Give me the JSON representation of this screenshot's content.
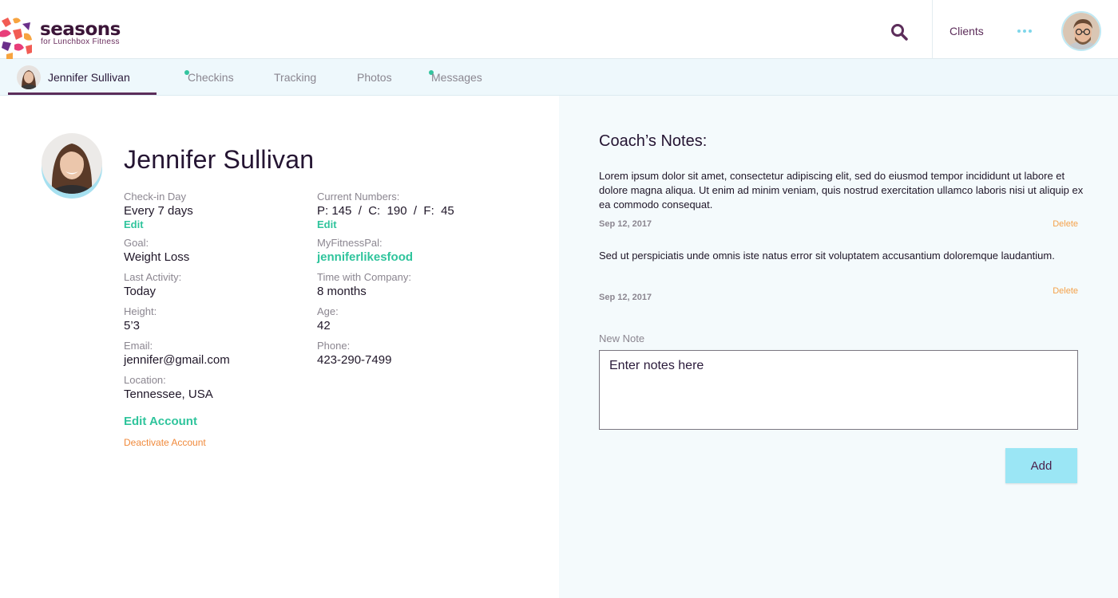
{
  "header": {
    "brand": "seasons",
    "brand_sub": "for Lunchbox Fitness",
    "clients_label": "Clients",
    "icons": {
      "search": "search-icon",
      "more": "more-dots-icon"
    },
    "colors": {
      "primary": "#5c2d5a",
      "accent": "#2fc49c",
      "light_accent": "#9be6f5",
      "warning": "#f08a3c"
    }
  },
  "tabs": [
    {
      "label": "Jennifer Sullivan",
      "active": true,
      "dot": false
    },
    {
      "label": "Checkins",
      "active": false,
      "dot": true
    },
    {
      "label": "Tracking",
      "active": false,
      "dot": false
    },
    {
      "label": "Photos",
      "active": false,
      "dot": false
    },
    {
      "label": "Messages",
      "active": false,
      "dot": true
    }
  ],
  "profile": {
    "name": "Jennifer Sullivan",
    "checkin_day": {
      "label": "Check-in Day",
      "value": "Every 7 days",
      "action": "Edit"
    },
    "current_numbers": {
      "label": "Current Numbers:",
      "value": "P: 145  /  C:  190  /  F:  45",
      "action": "Edit"
    },
    "goal": {
      "label": "Goal:",
      "value": "Weight Loss"
    },
    "myfitnesspal": {
      "label": "MyFitnessPal:",
      "value": "jenniferlikesfood"
    },
    "last_activity": {
      "label": "Last Activity:",
      "value": "Today"
    },
    "time_with_company": {
      "label": "Time with Company:",
      "value": "8 months"
    },
    "height": {
      "label": "Height:",
      "value": "5’3"
    },
    "age": {
      "label": "Age:",
      "value": "42"
    },
    "email": {
      "label": "Email:",
      "value": "jennifer@gmail.com"
    },
    "phone": {
      "label": "Phone:",
      "value": "423-290-7499"
    },
    "location": {
      "label": "Location:",
      "value": "Tennessee, USA"
    },
    "edit_account": "Edit Account",
    "deactivate_account": "Deactivate Account"
  },
  "notes": {
    "title": "Coach’s Notes:",
    "items": [
      {
        "text": "Lorem ipsum dolor sit amet, consectetur adipiscing elit, sed do eiusmod tempor incididunt ut labore et dolore magna aliqua. Ut enim ad minim veniam, quis nostrud exercitation ullamco laboris nisi ut aliquip ex ea commodo consequat.",
        "date": "Sep 12, 2017",
        "delete_label": "Delete"
      },
      {
        "text": "Sed ut perspiciatis unde omnis iste natus error sit voluptatem accusantium doloremque laudantium.",
        "date": "Sep 12, 2017",
        "delete_label": "Delete"
      }
    ],
    "new_note_label": "New Note",
    "new_note_placeholder": "Enter notes here",
    "add_label": "Add"
  }
}
